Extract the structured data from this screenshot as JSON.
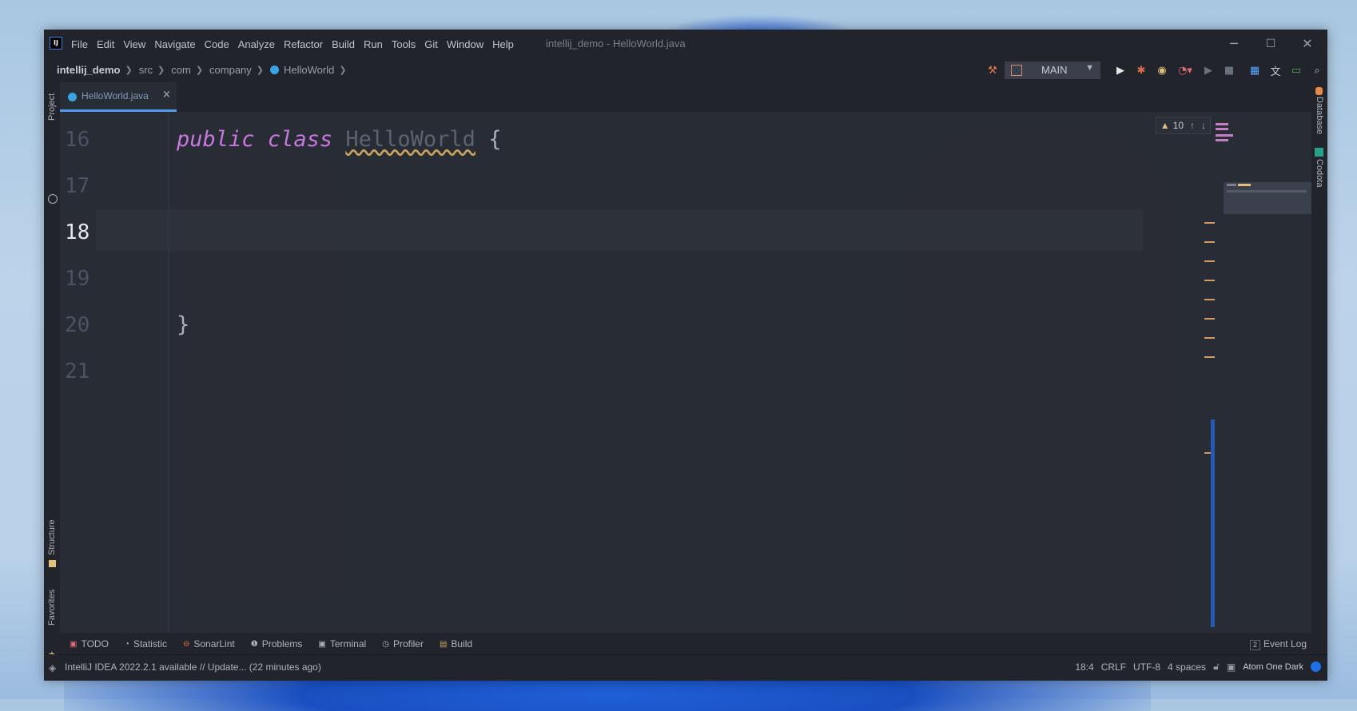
{
  "window": {
    "title": "intellij_demo - HelloWorld.java",
    "minimize": "─",
    "maximize": "☐",
    "close": "✕"
  },
  "menu": {
    "items": [
      {
        "label": "File"
      },
      {
        "label": "Edit"
      },
      {
        "label": "View"
      },
      {
        "label": "Navigate"
      },
      {
        "label": "Code"
      },
      {
        "label": "Analyze"
      },
      {
        "label": "Refactor"
      },
      {
        "label": "Build"
      },
      {
        "label": "Run"
      },
      {
        "label": "Tools"
      },
      {
        "label": "Git"
      },
      {
        "label": "Window"
      },
      {
        "label": "Help"
      }
    ]
  },
  "breadcrumb": {
    "items": [
      "intellij_demo",
      "src",
      "com",
      "company",
      "HelloWorld"
    ]
  },
  "toolbar": {
    "run_config": "MAIN"
  },
  "left_strip": {
    "project": "Project",
    "structure": "Structure",
    "favorites": "Favorites"
  },
  "right_strip": {
    "database": "Database",
    "codota": "Codota"
  },
  "editor": {
    "tab": "HelloWorld.java",
    "tab_close": "×",
    "inspections_count": "10",
    "line_numbers": [
      "16",
      "17",
      "18",
      "19",
      "20",
      "21"
    ],
    "current_line": "18",
    "code": {
      "kw_public": "public",
      "kw_class": "class",
      "class_name": "HelloWorld",
      "open_brace": "{",
      "close_brace": "}"
    }
  },
  "bottom_tools": {
    "items": [
      "TODO",
      "Statistic",
      "SonarLint",
      "Problems",
      "Terminal",
      "Profiler",
      "Build"
    ],
    "event_log": "Event Log",
    "event_log_count": "2"
  },
  "status": {
    "message": "IntelliJ IDEA 2022.2.1 available // Update... (22 minutes ago)",
    "position": "18:4",
    "line_sep": "CRLF",
    "encoding": "UTF-8",
    "indent": "4 spaces",
    "theme": "Atom One Dark"
  },
  "colors": {
    "accent": "#4d9bf0",
    "keyword": "#c678dd",
    "warning": "#e5c07b"
  },
  "icons": [
    "app-logo-icon",
    "hammer-icon",
    "run-icon",
    "debug-icon",
    "coverage-icon",
    "profiler-icon",
    "stop-icon",
    "search-icon",
    "translate-icon",
    "terminal-icon",
    "layers-icon",
    "lock-icon"
  ]
}
